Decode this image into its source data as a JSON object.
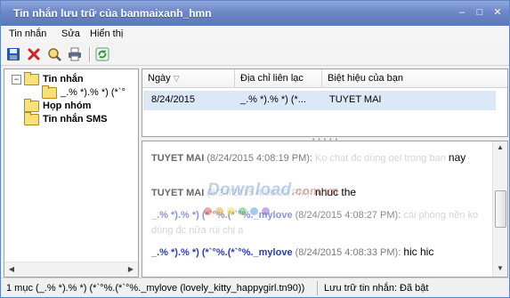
{
  "window": {
    "title": "Tin nhắn lưu trữ của banmaixanh_hmn"
  },
  "titlebar_buttons": [
    {
      "name": "minimize-button",
      "glyph": "–"
    },
    {
      "name": "maximize-button",
      "glyph": "□"
    },
    {
      "name": "close-button",
      "glyph": "✕"
    }
  ],
  "menu": {
    "items": [
      "Tin nhắn",
      "Sửa",
      "Hiển thị"
    ]
  },
  "toolbar": {
    "icons": [
      "save-icon",
      "delete-icon",
      "find-icon",
      "print-icon",
      "refresh-icon"
    ],
    "colors": {
      "save": "#2b57a8",
      "delete": "#d32020",
      "find": "#c9a240",
      "print": "#5a6b85",
      "refresh": "#2f8f3a"
    }
  },
  "tree": {
    "items": [
      {
        "label": "Tin nhắn",
        "level": 0,
        "expanded": true,
        "bold": true
      },
      {
        "label": "_.% *).% *) (*`°",
        "level": 1,
        "bold": false
      },
      {
        "label": "Họp nhóm",
        "level": 0,
        "bold": true
      },
      {
        "label": "Tin nhắn SMS",
        "level": 0,
        "bold": true
      }
    ]
  },
  "list": {
    "columns": [
      "Ngày",
      "Địa chỉ liên lạc",
      "Biệt hiệu của bạn"
    ],
    "rows": [
      {
        "date": "8/24/2015",
        "contact": "_.% *).% *) (*...",
        "nickname": "TUYET MAI"
      }
    ]
  },
  "chat": {
    "messages": [
      {
        "sender": "TUYET MAI",
        "time": "(8/24/2015 4:08:19 PM):",
        "faded": "Ko chat đc dùng oel trong ban",
        "text": "nay"
      },
      {
        "sender": "TUYET MAI",
        "time": "(8/24/2015 4:08:22 PM):",
        "faded": "",
        "text": "nhuc the"
      },
      {
        "sender": "_.% *).% *) (*`°%.(*`°%._mylove",
        "time": "(8/24/2015 4:08:27 PM):",
        "faded": "cái phòng nền ko dùng đc nữa rùi chị a",
        "text": ""
      },
      {
        "sender": "_.% *).% *) (*`°%.(*`°%._mylove",
        "time": "(8/24/2015 4:08:33 PM):",
        "faded": "",
        "text": "hic hic"
      }
    ]
  },
  "watermark": {
    "main": "Download",
    "tld": ".com.vn",
    "dot_colors": [
      "#e23b3b",
      "#f29a1f",
      "#f2d21f",
      "#3cae4a",
      "#2a8fe0",
      "#7a4fc9"
    ]
  },
  "status": {
    "left": "1 mục (_.% *).% *) (*`°%.(*`°%._mylove (lovely_kitty_happygirl.tn90))",
    "right": "Lưu trữ tin nhắn: Đã bật"
  },
  "colors": {
    "title_bar": "#6d87c8",
    "selection": "#dce8f6",
    "sender_self": "#676767",
    "sender_other": "#2a3bbf"
  }
}
